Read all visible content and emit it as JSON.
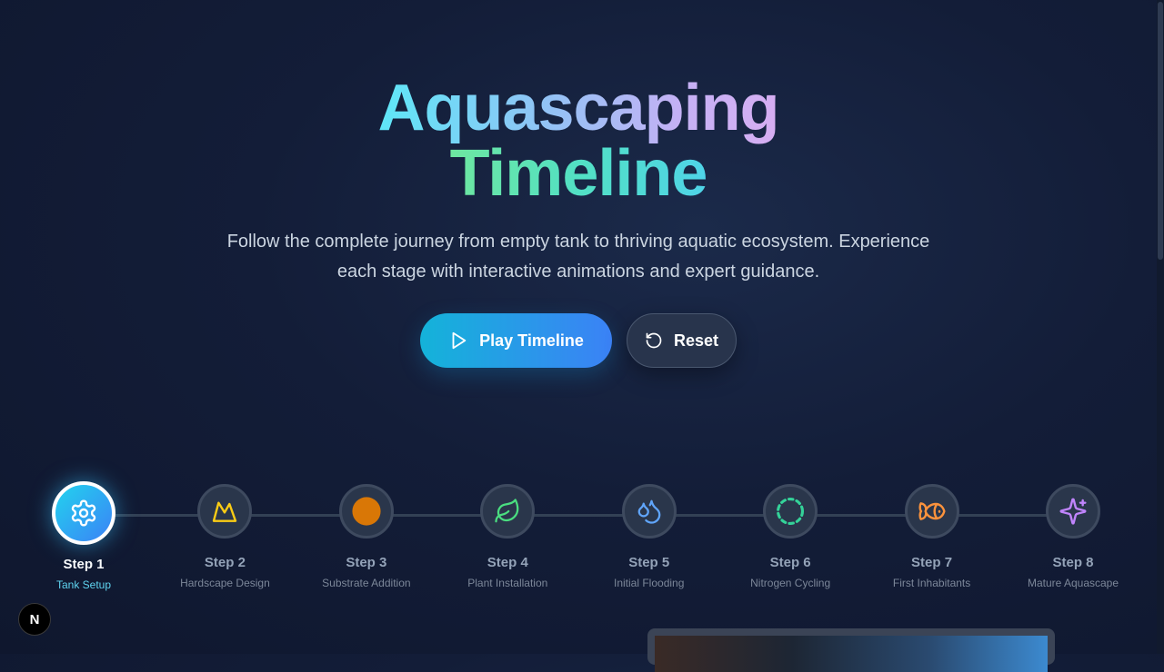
{
  "hero": {
    "title_line1": "Aquascaping",
    "title_line2": "Timeline",
    "subtitle": "Follow the complete journey from empty tank to thriving aquatic ecosystem. Experience each stage with interactive animations and expert guidance."
  },
  "buttons": {
    "play_label": "Play Timeline",
    "reset_label": "Reset"
  },
  "timeline": {
    "active_step": 1,
    "steps": [
      {
        "title": "Step 1",
        "subtitle": "Tank Setup",
        "icon": "gear-icon",
        "color": "#ffffff"
      },
      {
        "title": "Step 2",
        "subtitle": "Hardscape Design",
        "icon": "mountain-icon",
        "color": "#facc15"
      },
      {
        "title": "Step 3",
        "subtitle": "Substrate Addition",
        "icon": "circle-icon",
        "color": "#d97706"
      },
      {
        "title": "Step 4",
        "subtitle": "Plant Installation",
        "icon": "leaf-icon",
        "color": "#4ade80"
      },
      {
        "title": "Step 5",
        "subtitle": "Initial Flooding",
        "icon": "droplets-icon",
        "color": "#60a5fa"
      },
      {
        "title": "Step 6",
        "subtitle": "Nitrogen Cycling",
        "icon": "dashed-circle-icon",
        "color": "#34d399"
      },
      {
        "title": "Step 7",
        "subtitle": "First Inhabitants",
        "icon": "fish-icon",
        "color": "#fb923c"
      },
      {
        "title": "Step 8",
        "subtitle": "Mature Aquascape",
        "icon": "sparkles-icon",
        "color": "#c084fc"
      }
    ]
  },
  "badge": {
    "label": "N"
  }
}
